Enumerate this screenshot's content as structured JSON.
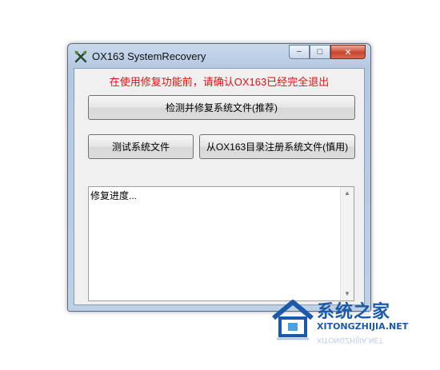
{
  "window": {
    "title": "OX163 SystemRecovery",
    "controls": {
      "minimize": "−",
      "maximize": "□",
      "close": "✕"
    }
  },
  "notice": "在使用修复功能前，请确认OX163已经完全退出",
  "buttons": {
    "detect": "检测并修复系统文件(推荐)",
    "test": "测试系统文件",
    "register": "从OX163目录注册系统文件(慎用)"
  },
  "log": {
    "text": "修复进度..."
  },
  "watermark": {
    "cn": "系统之家",
    "en": "XITONGZHIJIA.NET"
  },
  "icons": {
    "app": "tools-icon",
    "scroll_up": "scroll-up-icon",
    "scroll_down": "scroll-down-icon"
  },
  "colors": {
    "notice": "#e01010",
    "watermark": "#1a5aa8"
  }
}
